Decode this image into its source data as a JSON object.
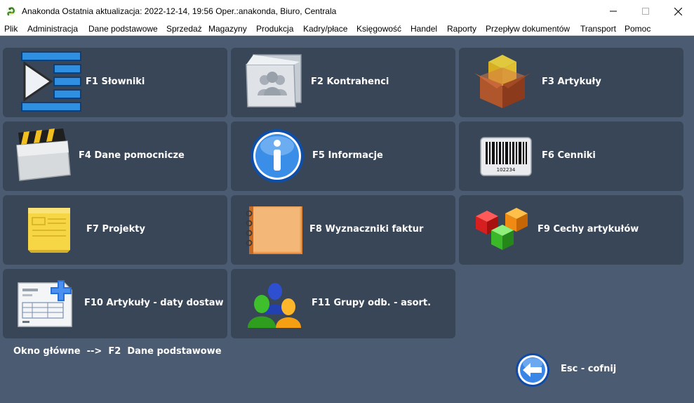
{
  "window": {
    "title": "Anakonda Ostatnia aktualizacja: 2022-12-14, 19:56 Oper.:anakonda, Biuro, Centrala",
    "app_icon": "snake-icon",
    "minimize_icon": "minimize-icon",
    "maximize_icon": "maximize-icon",
    "close_icon": "close-icon"
  },
  "menu": {
    "items": [
      "Plik",
      "Administracja",
      "Dane podstawowe",
      "Sprzedaż",
      "Magazyny",
      "Produkcja",
      "Kadry/płace",
      "Księgowość",
      "Handel",
      "Raporty",
      "Przepływ dokumentów",
      "Transport",
      "Pomoc"
    ]
  },
  "tiles": [
    {
      "label": "F1 Słowniki",
      "icon": "play-list-icon"
    },
    {
      "label": "F2 Kontrahenci",
      "icon": "contacts-folder-icon"
    },
    {
      "label": "F3 Artykuły",
      "icon": "box-icon"
    },
    {
      "label": "F4 Dane pomocnicze",
      "icon": "folder-icon"
    },
    {
      "label": "F5 Informacje",
      "icon": "info-icon"
    },
    {
      "label": "F6 Cenniki",
      "icon": "barcode-icon"
    },
    {
      "label": "F7 Projekty",
      "icon": "sticky-note-icon"
    },
    {
      "label": "F8 Wyznaczniki faktur",
      "icon": "notebook-icon"
    },
    {
      "label": "F9 Cechy artykułów",
      "icon": "cubes-icon"
    },
    {
      "label": "F10 Artykuły - daty dostaw",
      "icon": "document-add-icon"
    },
    {
      "label": "F11 Grupy odb. - asort.",
      "icon": "users-group-icon"
    }
  ],
  "barcode_number": "102234",
  "breadcrumb": "Okno główne  -->  F2  Dane podstawowe",
  "back_button": {
    "label": "Esc - cofnij",
    "icon": "arrow-left-icon"
  },
  "colors": {
    "background": "#4b5b71",
    "tile": "#394657",
    "text": "#ffffff"
  }
}
